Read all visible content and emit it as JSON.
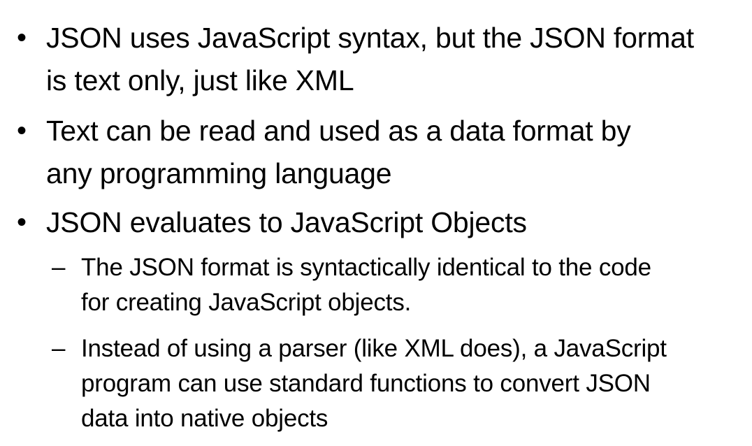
{
  "slide": {
    "bullets": [
      {
        "marker": "•",
        "text": "JSON uses JavaScript syntax, but the JSON format\nis text only, just like XML"
      },
      {
        "marker": "•",
        "text": "Text can be read and used as a data format by\nany programming language"
      },
      {
        "marker": "•",
        "text": "JSON evaluates to JavaScript Objects",
        "sub_items": [
          {
            "marker": "–",
            "text": "The JSON format is syntactically identical to the code\nfor creating JavaScript objects."
          },
          {
            "marker": "–",
            "text": "Instead of using a parser (like XML does), a JavaScript\nprogram can use standard functions to convert JSON\ndata into native objects"
          }
        ]
      }
    ]
  }
}
